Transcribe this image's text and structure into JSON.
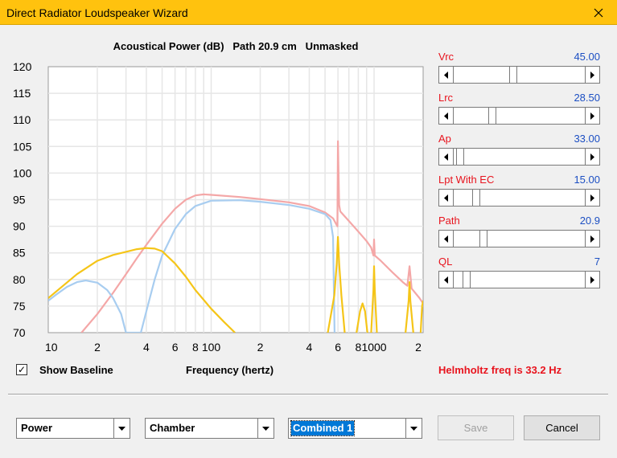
{
  "window": {
    "title": "Direct Radiator Loudspeaker Wizard"
  },
  "chart_title": "Acoustical Power (dB)   Path 20.9 cm   Unmasked",
  "chart_data": {
    "type": "line",
    "title": "Acoustical Power (dB)   Path 20.9 cm   Unmasked",
    "xlabel": "Frequency (hertz)",
    "ylabel": "",
    "x_scale": "log",
    "xlim": [
      10,
      2000
    ],
    "ylim": [
      70,
      120
    ],
    "grid": true,
    "y_ticks": [
      "120",
      "115",
      "110",
      "105",
      "100",
      "95",
      "90",
      "85",
      "80",
      "75",
      "70"
    ],
    "x_ticks": [
      {
        "value": 10,
        "label": "10"
      },
      {
        "value": 20,
        "label": "2"
      },
      {
        "value": 40,
        "label": "4"
      },
      {
        "value": 60,
        "label": "6"
      },
      {
        "value": 80,
        "label": "8"
      },
      {
        "value": 100,
        "label": "100"
      },
      {
        "value": 200,
        "label": "2"
      },
      {
        "value": 400,
        "label": "4"
      },
      {
        "value": 600,
        "label": "6"
      },
      {
        "value": 800,
        "label": "8"
      },
      {
        "value": 1000,
        "label": "1000"
      },
      {
        "value": 2000,
        "label": "2"
      }
    ],
    "series": [
      {
        "color": "#f4a7a7",
        "points": [
          [
            16,
            70
          ],
          [
            20,
            73.5
          ],
          [
            25,
            77.5
          ],
          [
            30,
            81
          ],
          [
            35,
            84
          ],
          [
            40,
            86.5
          ],
          [
            50,
            90.5
          ],
          [
            60,
            93.3
          ],
          [
            70,
            95
          ],
          [
            80,
            95.8
          ],
          [
            90,
            96
          ],
          [
            100,
            95.9
          ],
          [
            150,
            95.5
          ],
          [
            200,
            95.1
          ],
          [
            300,
            94.5
          ],
          [
            400,
            93.8
          ],
          [
            500,
            92.6
          ],
          [
            560,
            91.5
          ],
          [
            595,
            90
          ],
          [
            600,
            106
          ],
          [
            610,
            94
          ],
          [
            620,
            92.8
          ],
          [
            700,
            91
          ],
          [
            800,
            89
          ],
          [
            900,
            87.2
          ],
          [
            960,
            86
          ],
          [
            990,
            84.5
          ],
          [
            1000,
            87.5
          ],
          [
            1010,
            84.5
          ],
          [
            1100,
            83.5
          ],
          [
            1300,
            81.3
          ],
          [
            1500,
            79.5
          ],
          [
            1600,
            78.8
          ],
          [
            1650,
            82.5
          ],
          [
            1700,
            78.3
          ],
          [
            1900,
            76.5
          ],
          [
            2000,
            75.5
          ]
        ]
      },
      {
        "color": "#a8cdf0",
        "points": [
          [
            10,
            76
          ],
          [
            11,
            77
          ],
          [
            13,
            78.6
          ],
          [
            15,
            79.5
          ],
          [
            17,
            79.8
          ],
          [
            20,
            79.4
          ],
          [
            23,
            78
          ],
          [
            25,
            76.5
          ],
          [
            28,
            73.5
          ],
          [
            30,
            70
          ],
          [
            37,
            70
          ],
          [
            40,
            74
          ],
          [
            45,
            80
          ],
          [
            50,
            84.5
          ],
          [
            60,
            89.5
          ],
          [
            70,
            92.3
          ],
          [
            80,
            93.8
          ],
          [
            100,
            94.8
          ],
          [
            150,
            94.9
          ],
          [
            200,
            94.6
          ],
          [
            300,
            94
          ],
          [
            400,
            93.3
          ],
          [
            500,
            92.3
          ],
          [
            540,
            91.2
          ],
          [
            560,
            88
          ],
          [
            572,
            70
          ]
        ]
      },
      {
        "color": "#f5c518",
        "points": [
          [
            10,
            76.5
          ],
          [
            15,
            81
          ],
          [
            20,
            83.5
          ],
          [
            25,
            84.6
          ],
          [
            30,
            85.2
          ],
          [
            35,
            85.7
          ],
          [
            40,
            85.9
          ],
          [
            45,
            85.8
          ],
          [
            50,
            85.3
          ],
          [
            60,
            83
          ],
          [
            70,
            80.5
          ],
          [
            80,
            78
          ],
          [
            100,
            74.5
          ],
          [
            120,
            72
          ],
          [
            140,
            70
          ]
        ]
      },
      {
        "color": "#f5c518",
        "points": [
          [
            520,
            70
          ],
          [
            570,
            77
          ],
          [
            590,
            83
          ],
          [
            600,
            88
          ],
          [
            610,
            83
          ],
          [
            630,
            77
          ],
          [
            660,
            70
          ]
        ]
      },
      {
        "color": "#f5c518",
        "points": [
          [
            780,
            70
          ],
          [
            820,
            74
          ],
          [
            850,
            75.5
          ],
          [
            880,
            74
          ],
          [
            910,
            70
          ]
        ]
      },
      {
        "color": "#f5c518",
        "points": [
          [
            960,
            70
          ],
          [
            990,
            78
          ],
          [
            1000,
            82.5
          ],
          [
            1010,
            78
          ],
          [
            1040,
            70
          ]
        ]
      },
      {
        "color": "#f5c518",
        "points": [
          [
            1560,
            70
          ],
          [
            1630,
            76
          ],
          [
            1650,
            79.5
          ],
          [
            1670,
            76
          ],
          [
            1740,
            70
          ]
        ]
      },
      {
        "color": "#f5c518",
        "points": [
          [
            1930,
            70
          ],
          [
            1970,
            75
          ],
          [
            2000,
            76
          ]
        ]
      }
    ]
  },
  "controls": [
    {
      "label": "Vrc",
      "value": "45.00",
      "fraction": 0.45
    },
    {
      "label": "Lrc",
      "value": "28.50",
      "fraction": 0.28
    },
    {
      "label": "Ap",
      "value": "33.00",
      "fraction": 0.02
    },
    {
      "label": "Lpt  With EC",
      "value": "15.00",
      "fraction": 0.15
    },
    {
      "label": "Path",
      "value": "20.9",
      "fraction": 0.21
    },
    {
      "label": "QL",
      "value": "7",
      "fraction": 0.07
    }
  ],
  "baseline": {
    "checked": true,
    "label": "Show Baseline",
    "check_glyph": "✓"
  },
  "x_axis_label": "Frequency (hertz)",
  "helmholtz": "Helmholtz freq is 33.2 Hz",
  "dropdowns": {
    "first": "Power",
    "second": "Chamber",
    "third": "Combined 1"
  },
  "buttons": {
    "save": "Save",
    "cancel": "Cancel"
  }
}
